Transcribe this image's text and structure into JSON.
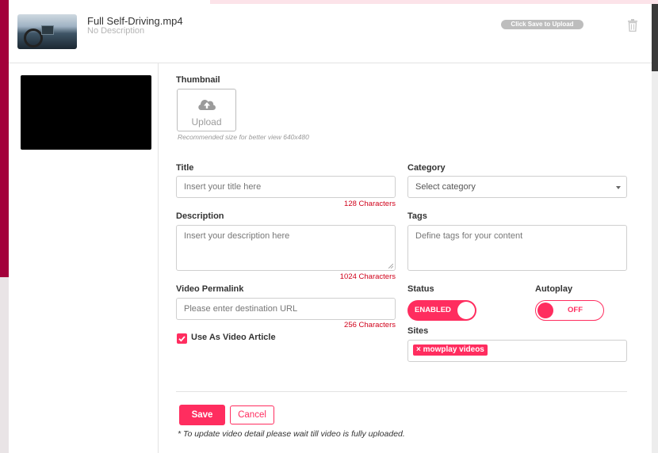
{
  "file": {
    "name": "Full Self-Driving.mp4",
    "description": "No Description",
    "save_hint": "Click Save to Upload"
  },
  "thumbnail": {
    "label": "Thumbnail",
    "upload_label": "Upload",
    "hint": "Recommended size for better view 640x480"
  },
  "title": {
    "label": "Title",
    "placeholder": "Insert your title here",
    "counter": "128 Characters"
  },
  "category": {
    "label": "Category",
    "selected": "Select category"
  },
  "description": {
    "label": "Description",
    "placeholder": "Insert your description here",
    "counter": "1024 Characters"
  },
  "tags": {
    "label": "Tags",
    "placeholder": "Define tags for your content"
  },
  "permalink": {
    "label": "Video Permalink",
    "placeholder": "Please enter destination URL",
    "counter": "256 Characters"
  },
  "status": {
    "label": "Status",
    "value": "ENABLED",
    "on": true
  },
  "autoplay": {
    "label": "Autoplay",
    "value": "OFF",
    "on": false
  },
  "article": {
    "label": "Use As Video Article",
    "checked": true
  },
  "sites": {
    "label": "Sites",
    "chips": [
      {
        "text": "× mowplay videos"
      }
    ]
  },
  "actions": {
    "save_label": "Save",
    "cancel_label": "Cancel",
    "note": "* To update video detail please wait till video is fully uploaded."
  },
  "colors": {
    "accent": "#ff2d5f",
    "counter": "#d0021b",
    "muted": "#bdbdbd"
  },
  "icons": [
    "trash-icon",
    "cloud-upload-icon",
    "caret-down-icon",
    "checkmark-icon",
    "resize-handle-icon"
  ]
}
